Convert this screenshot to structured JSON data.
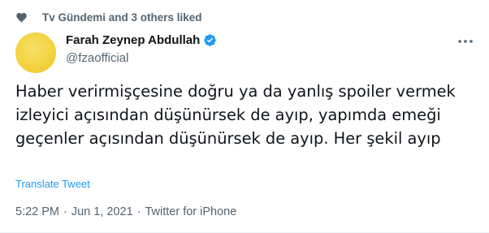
{
  "social_context": {
    "text": "Tv Gündemi and 3 others liked",
    "icon": "heart-icon"
  },
  "author": {
    "display_name": "Farah Zeynep Abdullah",
    "handle": "@fzaofficial",
    "verified": true,
    "avatar_color": "#f3d33f"
  },
  "tweet": {
    "text": "Haber verirmişçesine doğru ya da yanlış spoiler vermek izleyici açısından düşünürsek de ayıp, yapımda emeği geçenler açısından düşünürsek de ayıp. Her şekil ayıp",
    "translate_label": "Translate Tweet"
  },
  "meta": {
    "time": "5:22 PM",
    "separator": "·",
    "date": "Jun 1, 2021",
    "source": "Twitter for iPhone"
  },
  "colors": {
    "accent": "#1d9bf0",
    "secondary_text": "#536471",
    "primary_text": "#0f1419"
  }
}
